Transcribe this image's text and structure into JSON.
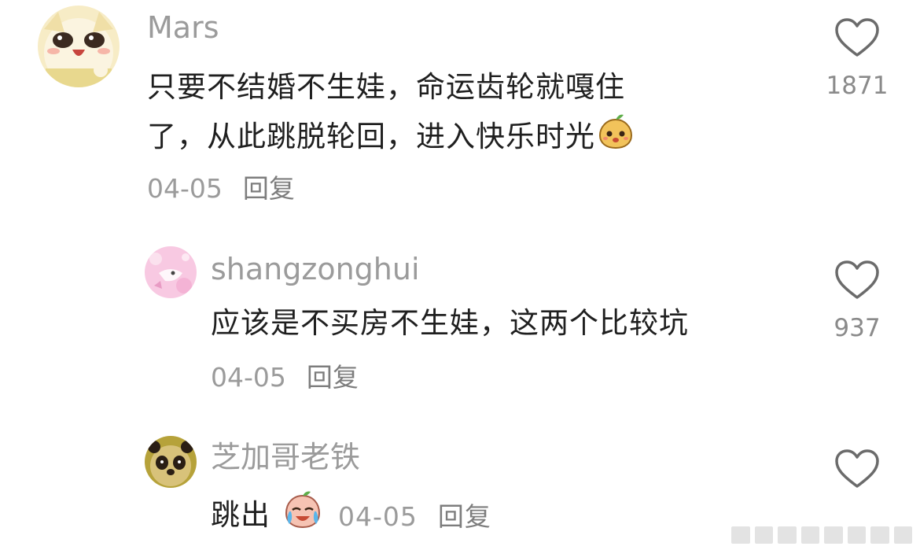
{
  "comments": [
    {
      "username": "Mars",
      "text_line1": "只要不结婚不生娃，命运齿轮就嘎住",
      "text_line2": "了，从此跳脱轮回，进入快乐时光",
      "emoji": "pear-face-emoji",
      "date": "04-05",
      "reply_label": "回复",
      "likes": "1871"
    },
    {
      "username": "shangzonghui",
      "text": "应该是不买房不生娃，这两个比较坑",
      "date": "04-05",
      "reply_label": "回复",
      "likes": "937"
    },
    {
      "username": "芝加哥老铁",
      "text": "跳出",
      "emoji": "crying-laughing-emoji",
      "date": "04-05",
      "reply_label": "回复",
      "likes": ""
    }
  ],
  "icons": {
    "like": "heart-outline-icon"
  },
  "colors": {
    "username": "#9b9b9b",
    "text": "#1f1f1f",
    "meta": "#9b9b9b",
    "heart_stroke": "#6b6b6b"
  }
}
